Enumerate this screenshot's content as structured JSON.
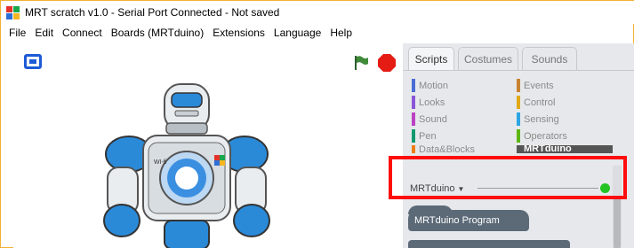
{
  "window": {
    "title": "MRT scratch v1.0 - Serial Port Connected - Not saved",
    "app_icon_colors": [
      "#e4322b",
      "#1aa74b",
      "#2d6fd6",
      "#f7b522"
    ]
  },
  "menu": {
    "items": [
      "File",
      "Edit",
      "Connect",
      "Boards (MRTduino)",
      "Extensions",
      "Language",
      "Help"
    ]
  },
  "stage": {
    "fullscreen_icon": "fullscreen-icon",
    "flag_icon": "green-flag-icon",
    "stop_icon": "stop-icon",
    "sprite": "robot-sprite",
    "sprite_chest_label": "WI-fi"
  },
  "tabs": [
    {
      "label": "Scripts",
      "active": true
    },
    {
      "label": "Costumes",
      "active": false
    },
    {
      "label": "Sounds",
      "active": false
    }
  ],
  "categories": {
    "left": [
      {
        "label": "Motion",
        "color": "#4a6cd4"
      },
      {
        "label": "Looks",
        "color": "#8a55d7"
      },
      {
        "label": "Sound",
        "color": "#bb42c3"
      },
      {
        "label": "Pen",
        "color": "#0e9a6c"
      },
      {
        "label": "Data&Blocks",
        "color": "#ee7d16"
      }
    ],
    "right": [
      {
        "label": "Events",
        "color": "#c88330"
      },
      {
        "label": "Control",
        "color": "#e1a91a"
      },
      {
        "label": "Sensing",
        "color": "#2ca5e2"
      },
      {
        "label": "Operators",
        "color": "#5cb712"
      },
      {
        "label": "MRTduino",
        "color": "#555555",
        "selected": true
      }
    ]
  },
  "extension": {
    "title": "MRTduino",
    "caret": "▼",
    "status_color": "#22c323"
  },
  "blocks": {
    "hat_label": "MRTduino Program"
  },
  "highlight_color": "#ff0d0d"
}
